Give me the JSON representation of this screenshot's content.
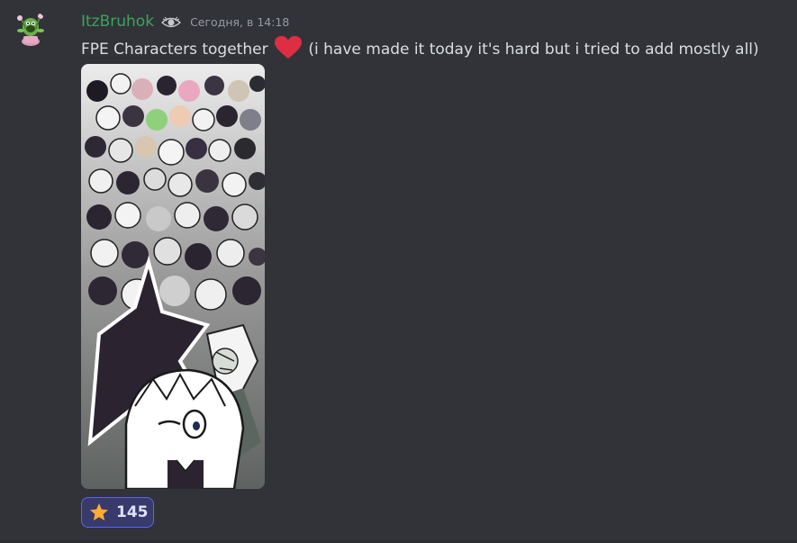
{
  "message": {
    "author": {
      "name": "ItzBruhok",
      "name_color": "#3ba55c",
      "avatar_icon": "plant-creature-avatar",
      "badge_icon": "eye-icon"
    },
    "timestamp": "Сегодня, в 14:18",
    "text_before_emoji": "FPE Characters together",
    "inline_emoji": "red-heart-icon",
    "text_after_emoji": "(i have made it today it's hard but i tried to add mostly all)",
    "attachment": {
      "type": "image",
      "subject": "collage-image"
    },
    "reactions": [
      {
        "emoji": "star-icon",
        "count": "145",
        "active": true
      }
    ]
  }
}
